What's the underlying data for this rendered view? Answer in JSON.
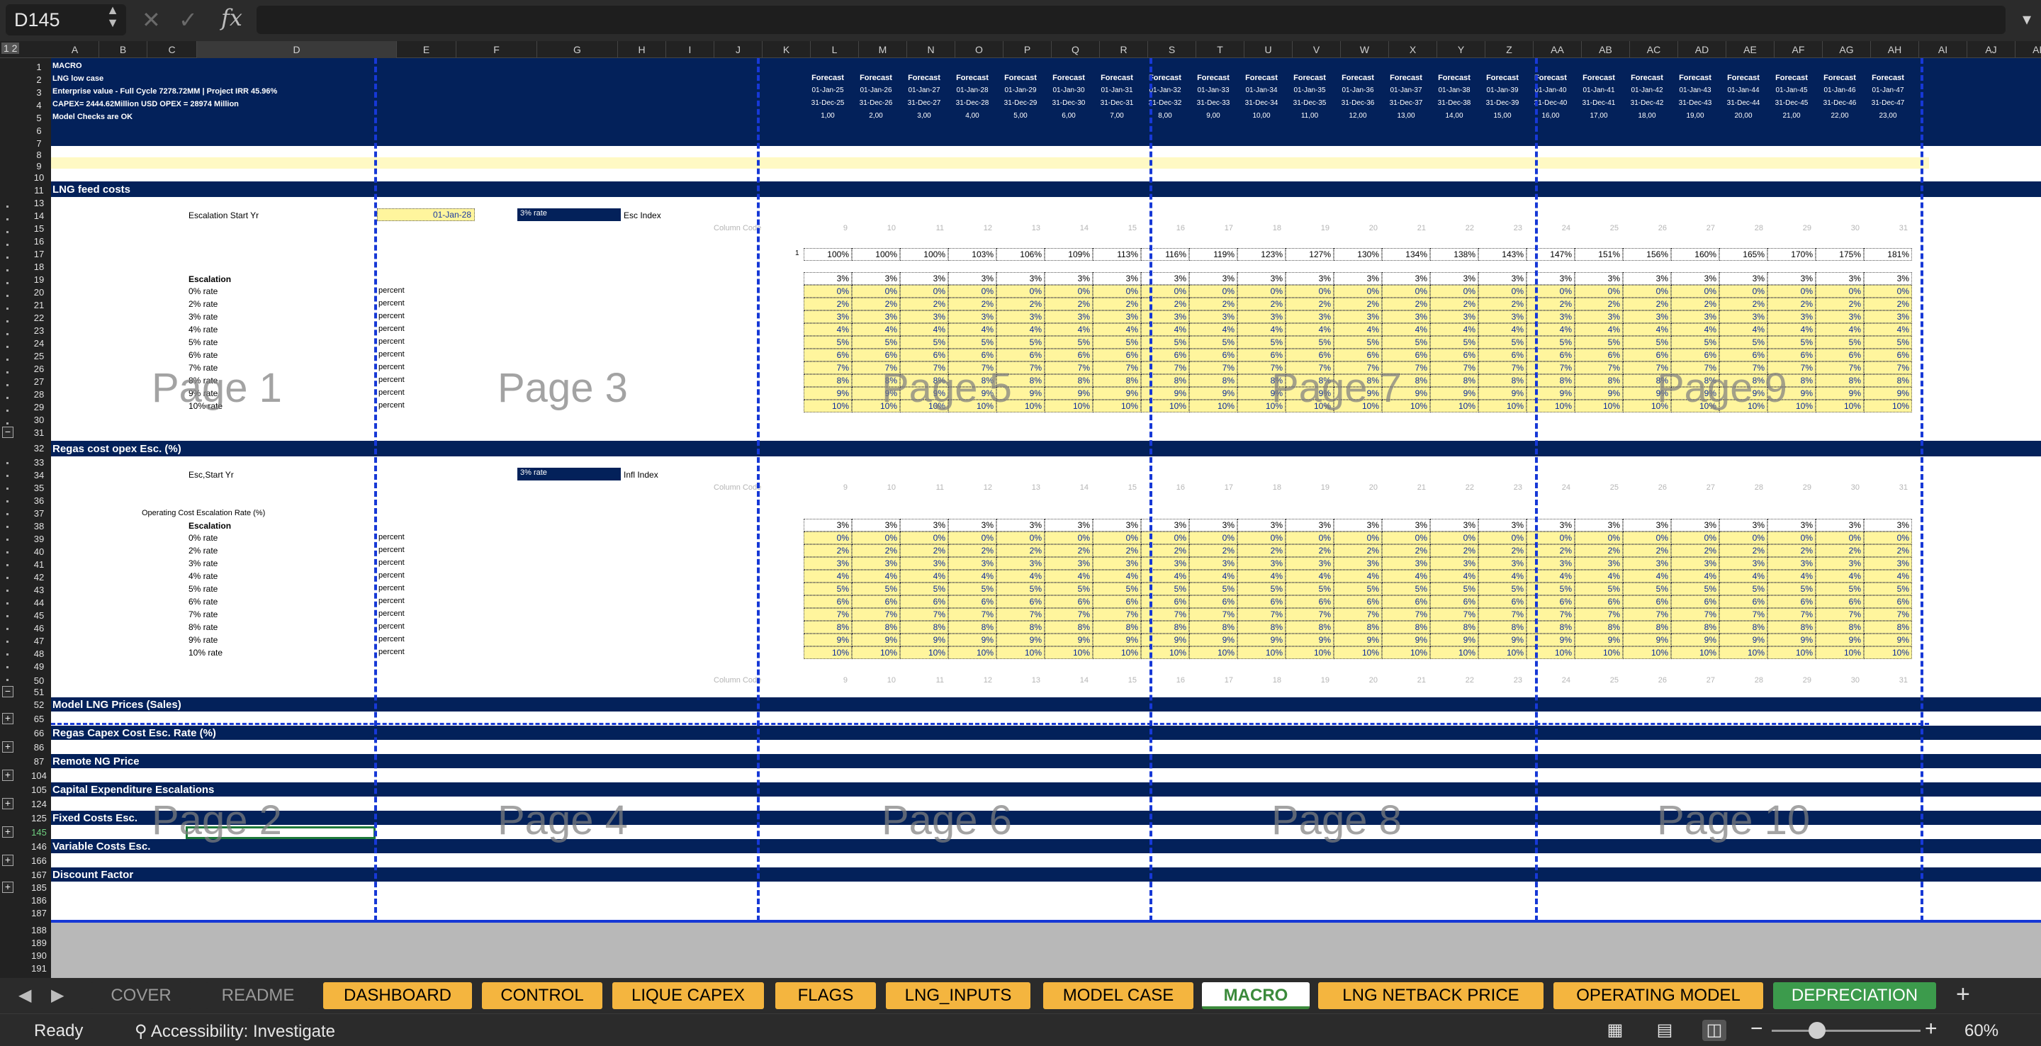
{
  "formula_bar": {
    "cell_ref": "D145",
    "stepper_glyph": "▲▼",
    "cancel_glyph": "✕",
    "enter_glyph": "✓",
    "fx_label": "fx",
    "formula_value": "",
    "expand_glyph": "▾"
  },
  "outline_levels": "1 2",
  "columns": [
    "A",
    "B",
    "C",
    "D",
    "E",
    "F",
    "G",
    "H",
    "I",
    "J",
    "K",
    "L",
    "M",
    "N",
    "O",
    "P",
    "Q",
    "R",
    "S",
    "T",
    "U",
    "V",
    "W",
    "X",
    "Y",
    "Z",
    "AA",
    "AB",
    "AC",
    "AD",
    "AE",
    "AF",
    "AG",
    "AH",
    "AI",
    "AJ",
    "AK"
  ],
  "rows": [
    "1",
    "2",
    "3",
    "4",
    "5",
    "6",
    "7",
    "8",
    "9",
    "10",
    "11",
    "13",
    "14",
    "15",
    "16",
    "17",
    "18",
    "19",
    "20",
    "21",
    "22",
    "23",
    "24",
    "25",
    "26",
    "27",
    "28",
    "29",
    "30",
    "31",
    "32",
    "33",
    "34",
    "35",
    "36",
    "37",
    "38",
    "39",
    "40",
    "41",
    "42",
    "43",
    "44",
    "45",
    "46",
    "47",
    "48",
    "49",
    "50",
    "51",
    "52",
    "65",
    "66",
    "86",
    "87",
    "104",
    "105",
    "124",
    "125",
    "145",
    "146",
    "166",
    "167",
    "185",
    "186",
    "187",
    "188",
    "189",
    "190",
    "191"
  ],
  "header_block": {
    "line1": "MACRO",
    "line2": "LNG low case",
    "line3": "Enterprise value - Full Cycle 7278.72MM | Project IRR 45.96%",
    "line4": "CAPEX= 2444.62Million USD OPEX = 28974 Million",
    "line5": "Model Checks are OK"
  },
  "forecast_label": "Forecast",
  "period_starts": [
    "01-Jan-25",
    "01-Jan-26",
    "01-Jan-27",
    "01-Jan-28",
    "01-Jan-29",
    "01-Jan-30",
    "01-Jan-31",
    "01-Jan-32",
    "01-Jan-33",
    "01-Jan-34",
    "01-Jan-35",
    "01-Jan-36",
    "01-Jan-37",
    "01-Jan-38",
    "01-Jan-39",
    "01-Jan-40",
    "01-Jan-41",
    "01-Jan-42",
    "01-Jan-43",
    "01-Jan-44",
    "01-Jan-45",
    "01-Jan-46",
    "01-Jan-47"
  ],
  "period_ends": [
    "31-Dec-25",
    "31-Dec-26",
    "31-Dec-27",
    "31-Dec-28",
    "31-Dec-29",
    "31-Dec-30",
    "31-Dec-31",
    "31-Dec-32",
    "31-Dec-33",
    "31-Dec-34",
    "31-Dec-35",
    "31-Dec-36",
    "31-Dec-37",
    "31-Dec-38",
    "31-Dec-39",
    "31-Dec-40",
    "31-Dec-41",
    "31-Dec-42",
    "31-Dec-43",
    "31-Dec-44",
    "31-Dec-45",
    "31-Dec-46",
    "31-Dec-47"
  ],
  "period_numbers": [
    "1,00",
    "2,00",
    "3,00",
    "4,00",
    "5,00",
    "6,00",
    "7,00",
    "8,00",
    "9,00",
    "10,00",
    "11,00",
    "12,00",
    "13,00",
    "14,00",
    "15,00",
    "16,00",
    "17,00",
    "18,00",
    "19,00",
    "20,00",
    "21,00",
    "22,00",
    "23,00"
  ],
  "sections": {
    "lng_feed": "LNG feed costs",
    "regas_opex": "Regas cost opex Esc. (%)",
    "model_lng": "Model LNG Prices (Sales)",
    "regas_capex": "Regas Capex Cost Esc. Rate (%)",
    "remote_ng": "Remote NG Price",
    "capex_esc": "Capital Expenditure Escalations",
    "fixed_costs": "Fixed Costs Esc.",
    "variable_costs": "Variable Costs Esc.",
    "discount": "Discount Factor"
  },
  "lng_block": {
    "escalation_start_label": "Escalation Start Yr",
    "escalation_start_value": "01-Jan-28",
    "rate_selector": "3% rate",
    "index_label": "Esc Index",
    "column_code_label": "Column Code",
    "column_codes": [
      "9",
      "10",
      "11",
      "12",
      "13",
      "14",
      "15",
      "16",
      "17",
      "18",
      "19",
      "20",
      "21",
      "22",
      "23",
      "24",
      "25",
      "26",
      "27",
      "28",
      "29",
      "30",
      "31"
    ],
    "index_row_lead": "1",
    "index_values": [
      "100%",
      "100%",
      "100%",
      "103%",
      "106%",
      "109%",
      "113%",
      "116%",
      "119%",
      "123%",
      "127%",
      "130%",
      "134%",
      "138%",
      "143%",
      "147%",
      "151%",
      "156%",
      "160%",
      "165%",
      "170%",
      "175%",
      "181%"
    ],
    "escalation_heading": "Escalation",
    "rate_labels": [
      "0% rate",
      "2% rate",
      "3% rate",
      "4% rate",
      "5% rate",
      "6% rate",
      "7% rate",
      "8% rate",
      "9% rate",
      "10% rate"
    ],
    "unit_label": "percent"
  },
  "opex_block": {
    "esc_start_label": "Esc,Start Yr",
    "rate_selector": "3% rate",
    "index_label": "Infl Index",
    "op_cost_label": "Operating Cost Escalation Rate (%)",
    "escalation_heading": "Escalation",
    "rate_labels": [
      "0% rate",
      "2% rate",
      "3% rate",
      "4% rate",
      "5% rate",
      "6% rate",
      "7% rate",
      "8% rate",
      "9% rate",
      "10% rate"
    ],
    "unit_label": "percent"
  },
  "escalation_headline": "3%",
  "rate_value_strings": [
    "0%",
    "2%",
    "3%",
    "4%",
    "5%",
    "6%",
    "7%",
    "8%",
    "9%",
    "10%"
  ],
  "page_watermarks": [
    "Page 1",
    "Page 3",
    "Page 5",
    "Page 7",
    "Page 9",
    "Page 2",
    "Page 4",
    "Page 6",
    "Page 8",
    "Page 10"
  ],
  "tabs": {
    "nav_prev": "◀",
    "nav_next": "▶",
    "items": [
      "COVER",
      "README",
      "DASHBOARD",
      "CONTROL",
      "LIQUE CAPEX",
      "FLAGS",
      "LNG_INPUTS",
      "MODEL CASE",
      "MACRO",
      "LNG NETBACK PRICE",
      "OPERATING MODEL",
      "DEPRECIATION"
    ],
    "add_glyph": "+"
  },
  "status": {
    "ready": "Ready",
    "accessibility": "Accessibility: Investigate",
    "zoom_minus": "−",
    "zoom_plus": "+",
    "zoom": "60%",
    "zoom_level_percent": 60
  },
  "colors": {
    "navy": "#03215a",
    "yellow_cell": "#fff59d",
    "tab_orange": "#f4b53f",
    "tab_green": "#3c9b4c",
    "page_break_blue": "#1638d6"
  }
}
